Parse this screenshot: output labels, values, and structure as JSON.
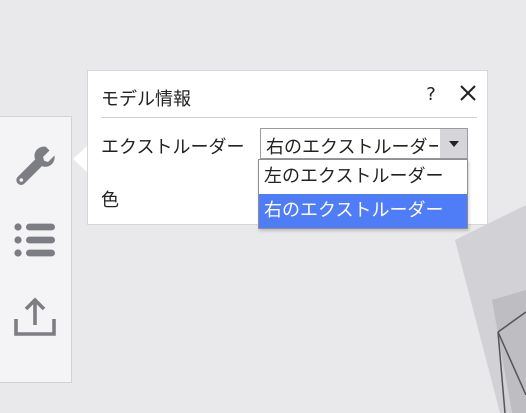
{
  "panel": {
    "title": "モデル情報",
    "help": "?",
    "extruder_label": "エクストルーダー",
    "color_label": "色",
    "extruder_select_value": "右のエクストルーダー",
    "extruder_options": [
      "左のエクストルーダー",
      "右のエクストルーダー"
    ],
    "selected_option_index": 1
  },
  "toolbar": {
    "tools": [
      "wrench-icon",
      "list-icon",
      "upload-icon"
    ],
    "active_tool": "wrench-icon"
  },
  "colors": {
    "highlight": "#4f7cf7",
    "icon": "#7d7d84",
    "background": "#e9e9ec"
  }
}
